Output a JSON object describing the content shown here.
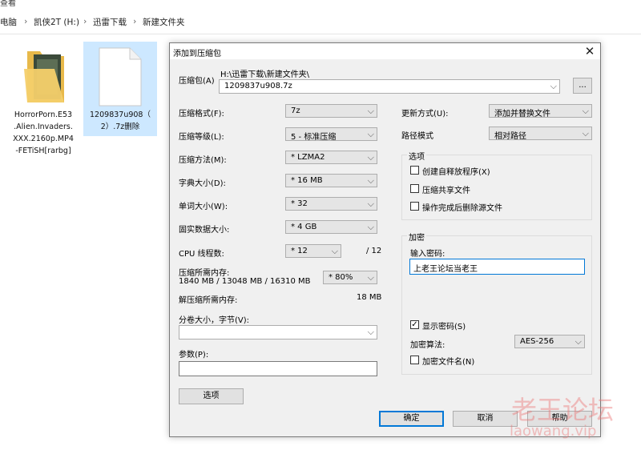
{
  "explorer": {
    "top_text": "查看",
    "breadcrumb": [
      "电脑",
      "凯侠2T (H:)",
      "迅雷下载",
      "新建文件夹"
    ],
    "files": [
      {
        "name_lines": [
          "HorrorPorn.E53",
          ".Alien.Invaders.",
          "XXX.2160p.MP4",
          "-FETiSH[rarbg]"
        ]
      },
      {
        "name_lines": [
          "1209837u908（",
          "2）.7z删除"
        ]
      }
    ]
  },
  "dialog": {
    "title": "添加到压缩包",
    "close": "✕",
    "archive_label": "压缩包(A)",
    "archive_path": "H:\\迅雷下载\\新建文件夹\\",
    "archive_name": "1209837u908.7z",
    "browse": "...",
    "left": [
      {
        "label": "压缩格式(F):",
        "value": "7z"
      },
      {
        "label": "压缩等级(L):",
        "value": "5 - 标准压缩"
      },
      {
        "label": "压缩方法(M):",
        "value": "* LZMA2"
      },
      {
        "label": "字典大小(D):",
        "value": "* 16 MB"
      },
      {
        "label": "单词大小(W):",
        "value": "* 32"
      },
      {
        "label": "固实数据大小:",
        "value": "* 4 GB"
      }
    ],
    "cpu": {
      "label": "CPU 线程数:",
      "value": "* 12",
      "max": "/ 12"
    },
    "mem_compress": {
      "label": "压缩所需内存:",
      "detail": "1840 MB / 13048 MB / 16310 MB",
      "value": "* 80%"
    },
    "mem_decompress": {
      "label": "解压缩所需内存:",
      "value": "18 MB"
    },
    "volume": {
      "label": "分卷大小，字节(V):",
      "value": ""
    },
    "params": {
      "label": "参数(P):",
      "value": ""
    },
    "options_button": "选项",
    "update": {
      "label": "更新方式(U):",
      "value": "添加并替换文件"
    },
    "pathmode": {
      "label": "路径模式",
      "value": "相对路径"
    },
    "options_group": {
      "title": "选项",
      "items": [
        {
          "label": "创建自释放程序(X)",
          "checked": false
        },
        {
          "label": "压缩共享文件",
          "checked": false
        },
        {
          "label": "操作完成后删除源文件",
          "checked": false
        }
      ]
    },
    "encrypt_group": {
      "title": "加密",
      "password_label": "输入密码:",
      "password_value": "上老王论坛当老王",
      "show_password": {
        "label": "显示密码(S)",
        "checked": true
      },
      "method_label": "加密算法:",
      "method_value": "AES-256",
      "encrypt_names": {
        "label": "加密文件名(N)",
        "checked": false
      }
    },
    "buttons": {
      "ok": "确定",
      "cancel": "取消",
      "help": "帮助"
    }
  },
  "watermark": {
    "line1": "老王论坛",
    "line2": "laowang.vip"
  }
}
